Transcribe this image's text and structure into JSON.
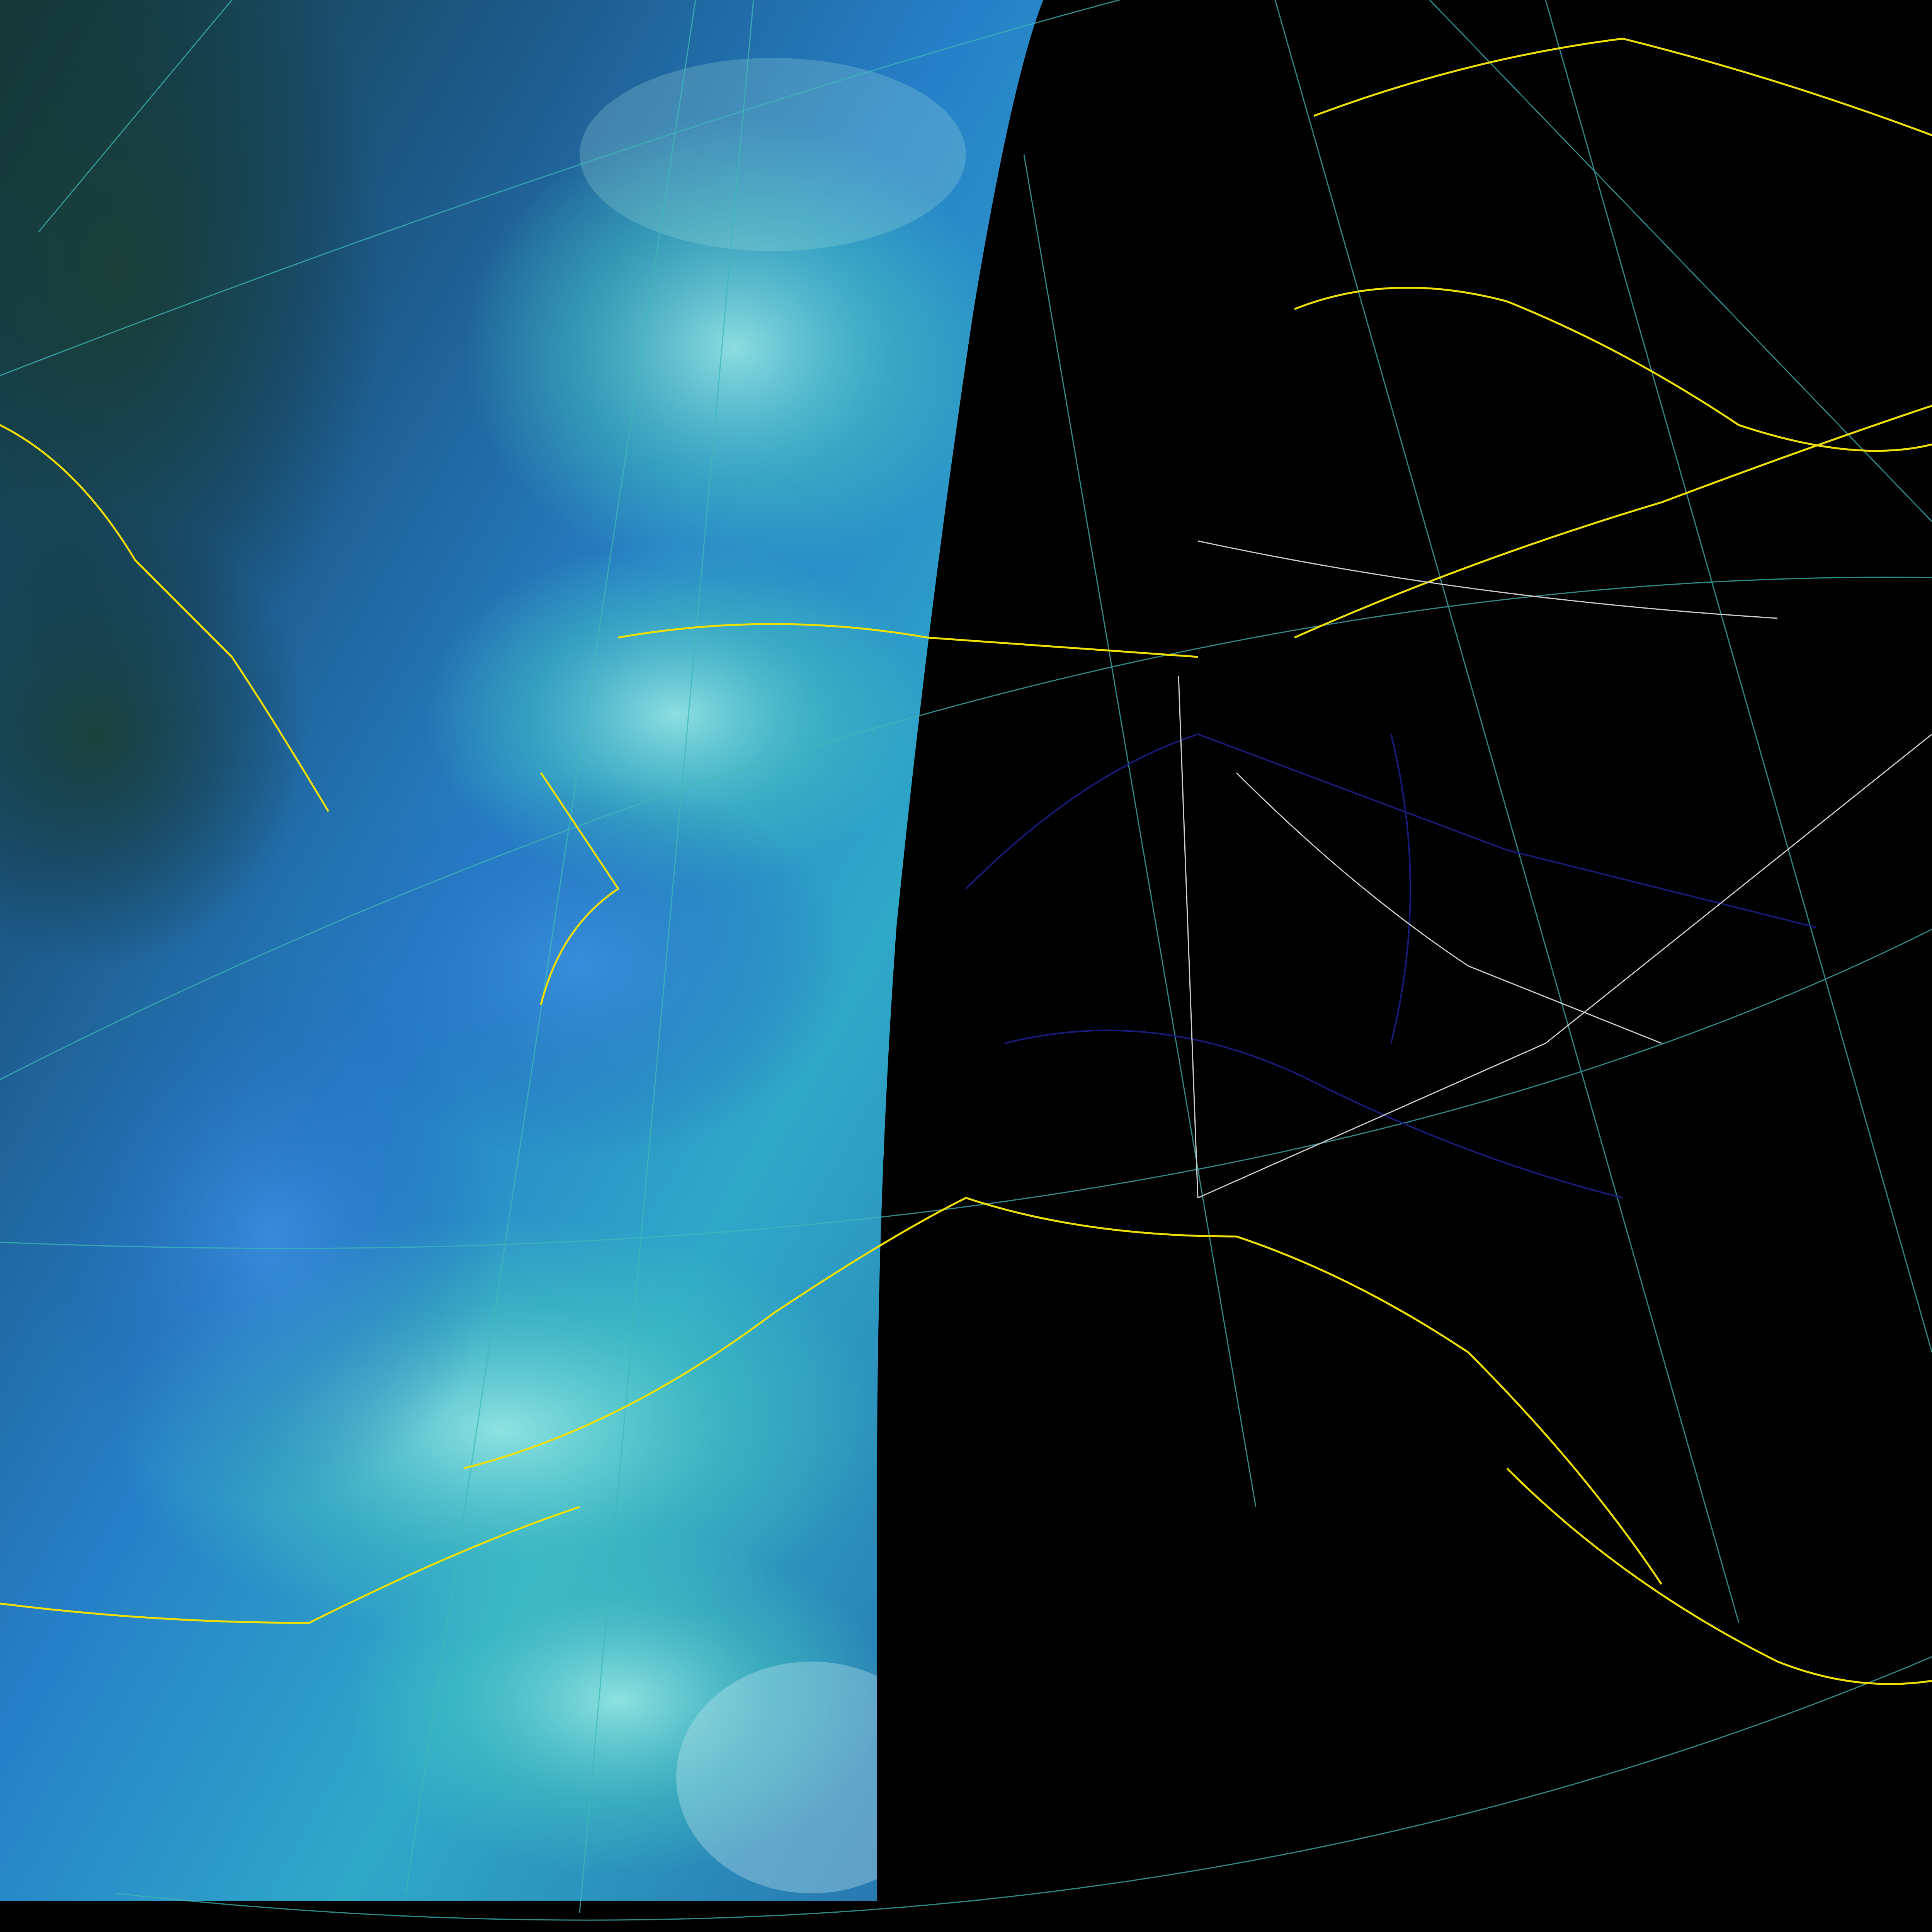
{
  "map": {
    "projection": "polar-stereographic",
    "background_color": "#000000",
    "imagery": {
      "palette": [
        "#0a2a2a",
        "#163c4a",
        "#1e6aa0",
        "#2a8fd8",
        "#3ec8c8",
        "#7fe6e0",
        "#c4f4f0"
      ],
      "description_colors": {
        "land_dark": "#14302c",
        "cloud_blue": "#2a7fd0",
        "cloud_cyan": "#48d0c8",
        "cloud_bright": "#bff2ee"
      }
    },
    "overlays": {
      "coastline_color": "#f0e000",
      "graticule_color": "#3fb8b8",
      "river_color": "#1a1f8a",
      "border_color": "#cfcfcf"
    }
  }
}
